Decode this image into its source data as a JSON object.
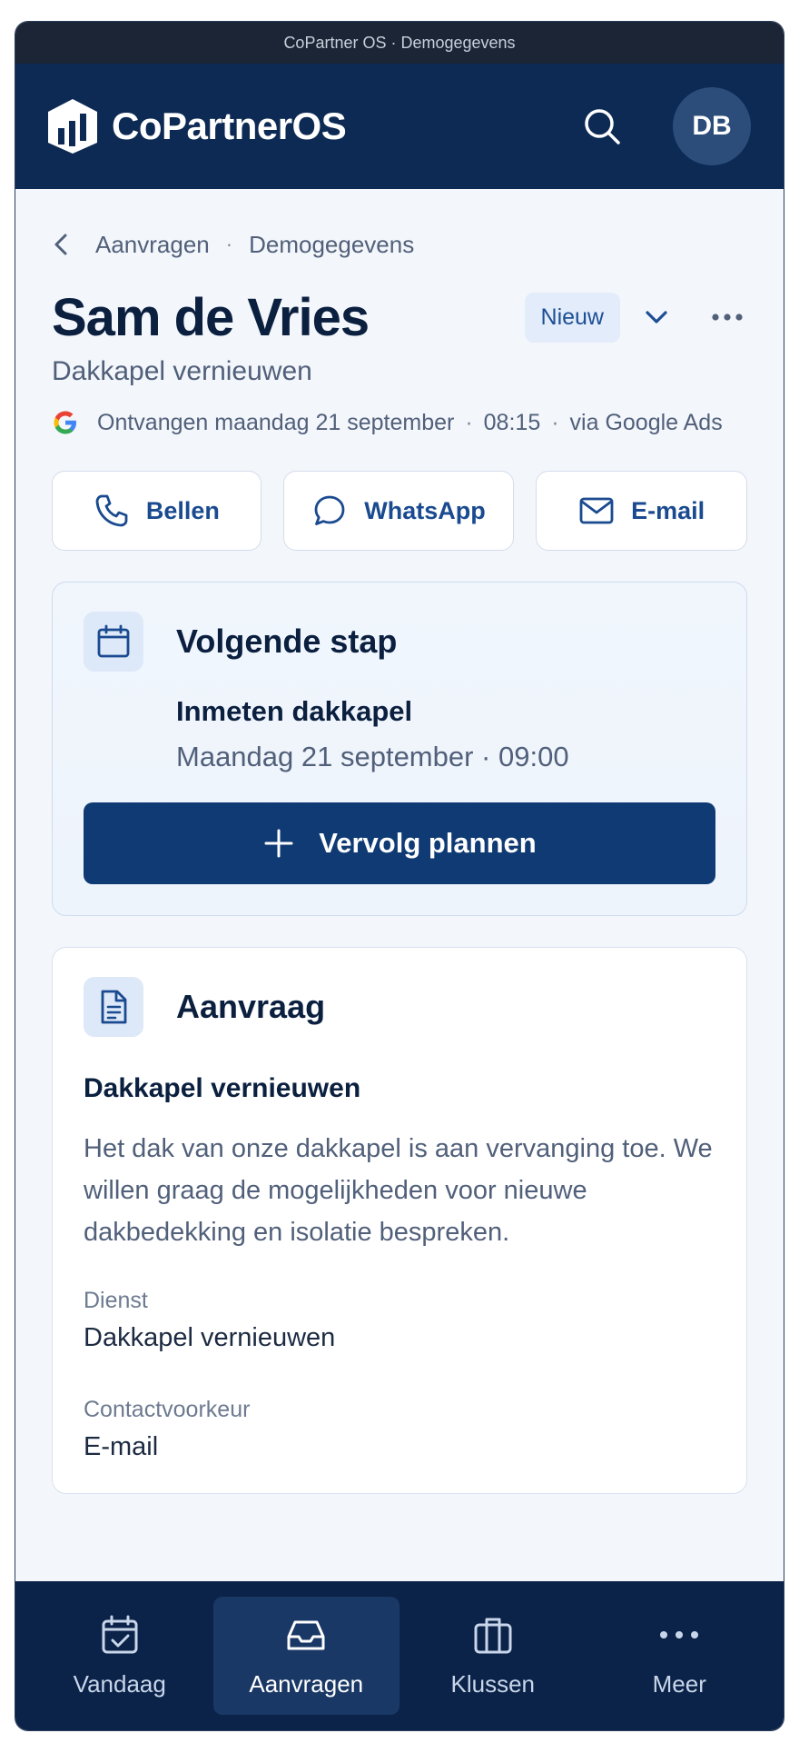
{
  "window": {
    "title": "CoPartner OS · Demogegevens"
  },
  "app": {
    "brand": "CoPartnerOS",
    "avatar_initials": "DB"
  },
  "breadcrumb": {
    "parent": "Aanvragen",
    "separator": "·",
    "current": "Demogegevens"
  },
  "lead": {
    "name": "Sam de Vries",
    "status": "Nieuw",
    "subtitle": "Dakkapel vernieuwen",
    "received": "Ontvangen maandag 21 september",
    "time": "08:15",
    "source": "via Google Ads",
    "dot": "·"
  },
  "actions": {
    "call": "Bellen",
    "whatsapp": "WhatsApp",
    "email": "E-mail"
  },
  "next_step": {
    "title": "Volgende stap",
    "item": "Inmeten dakkapel",
    "when": "Maandag 21 september · 09:00",
    "button": "Vervolg plannen"
  },
  "request": {
    "title": "Aanvraag",
    "subject": "Dakkapel vernieuwen",
    "body": "Het dak van onze dakkapel is aan vervanging toe. We willen graag de mogelijkheden voor nieuwe dakbedekking en isolatie bespreken.",
    "service_label": "Dienst",
    "service_value": "Dakkapel vernieuwen",
    "contact_label": "Contactvoorkeur",
    "contact_value": "E-mail"
  },
  "tabs": [
    {
      "label": "Vandaag",
      "icon": "calendar-check-icon"
    },
    {
      "label": "Aanvragen",
      "icon": "inbox-icon",
      "active": true
    },
    {
      "label": "Klussen",
      "icon": "briefcase-icon"
    },
    {
      "label": "Meer",
      "icon": "more-icon"
    }
  ],
  "colors": {
    "navy": "#0d2a54",
    "primary_button": "#0f3a74",
    "accent_text": "#1a4a8f",
    "badge_bg": "#e2ecfa"
  }
}
